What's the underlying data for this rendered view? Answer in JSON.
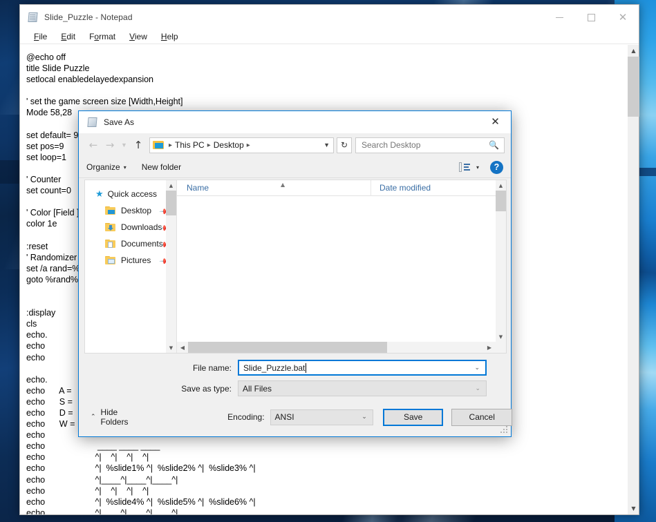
{
  "notepad": {
    "title": "Slide_Puzzle - Notepad",
    "icon": "notepad-icon",
    "menus": [
      {
        "label": "File",
        "accel": "F"
      },
      {
        "label": "Edit",
        "accel": "E"
      },
      {
        "label": "Format",
        "accel": "o"
      },
      {
        "label": "View",
        "accel": "V"
      },
      {
        "label": "Help",
        "accel": "H"
      }
    ],
    "window_controls": [
      {
        "name": "minimize-button",
        "glyph": "minimize"
      },
      {
        "name": "maximize-button",
        "glyph": "maximize"
      },
      {
        "name": "close-button",
        "glyph": "close"
      }
    ],
    "text": "@echo off\ntitle Slide Puzzle\nsetlocal enabledelayedexpansion\n\n' set the game screen size [Width,Height]\nMode 58,28\n\nset default= 9\nset pos=9\nset loop=1\n\n' Counter\nset count=0\n\n' Color [Field ]\ncolor 1e\n\n:reset\n' Randomizer\nset /a rand=%\ngoto %rand%\n\n\n:display\ncls\necho.\necho\necho\n\necho.\necho      A = \necho      S = \necho      D = \necho      W = \necho\necho                      ____ ____ ____\necho                     ^|    ^|    ^|    ^|\necho                     ^|  %slide1% ^|  %slide2% ^|  %slide3% ^|\necho                     ^|____^|____^|____^|\necho                     ^|    ^|    ^|    ^|\necho                     ^|  %slide4% ^|  %slide5% ^|  %slide6% ^|\necho                     ^|____^|____^|____^|",
    "scrollbar": {
      "name": "notepad-vertical-scrollbar"
    }
  },
  "dialog": {
    "title": "Save As",
    "icon": "notepad-icon",
    "close_label": "✕",
    "nav": {
      "back": "←",
      "forward": "→",
      "recent": "⌄",
      "up": "↑"
    },
    "breadcrumb": {
      "items": [
        "This PC",
        "Desktop"
      ],
      "separator": "›",
      "dropdown": "⌄"
    },
    "refresh_glyph": "↻",
    "search": {
      "placeholder": "Search Desktop",
      "value": "",
      "icon": "search-icon"
    },
    "toolbar": {
      "organize_label": "Organize",
      "new_folder_label": "New folder",
      "caret": "▾",
      "view_icon": "list-view-icon",
      "help_label": "?"
    },
    "sidebar": {
      "header": "Quick access",
      "items": [
        {
          "label": "Desktop",
          "icon": "desktop-folder-icon",
          "pinned": true
        },
        {
          "label": "Downloads",
          "icon": "downloads-folder-icon",
          "pinned": true
        },
        {
          "label": "Documents",
          "icon": "documents-folder-icon",
          "pinned": true
        },
        {
          "label": "Pictures",
          "icon": "pictures-folder-icon",
          "pinned": true
        }
      ]
    },
    "filelist": {
      "columns": [
        {
          "label": "Name",
          "sorted": "asc"
        },
        {
          "label": "Date modified"
        }
      ],
      "rows": []
    },
    "form": {
      "filename_label": "File name:",
      "filename_value": "Slide_Puzzle.bat",
      "filetype_label": "Save as type:",
      "filetype_value": "All Files",
      "combo_arrow": "⌄"
    },
    "footer": {
      "hide_folders_label": "Hide Folders",
      "hide_folders_caret": "⌃",
      "encoding_label": "Encoding:",
      "encoding_value": "ANSI",
      "save_label": "Save",
      "cancel_label": "Cancel"
    }
  },
  "colors": {
    "accent": "#0078d7",
    "header_text": "#3a6ea5",
    "desktop": "#0b2a52"
  }
}
